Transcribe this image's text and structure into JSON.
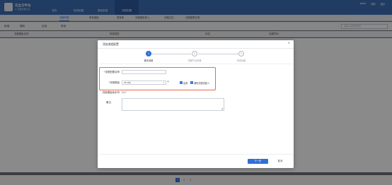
{
  "app": {
    "brand": "云立方平台",
    "brand_sub": "IT 运维管理平台",
    "nav": [
      "首页",
      "系统配置",
      "基础数据",
      "流程配置"
    ],
    "topright": [
      "admin",
      "帮助",
      "退出"
    ]
  },
  "subtabs": [
    "流程列表",
    "审批模板",
    "表单库",
    "流程模板导入",
    "流程日志",
    "流程配置记录"
  ],
  "toolbar": {
    "add": "新增",
    "delete": "删除",
    "enable": "启用",
    "disable": "禁用",
    "search_placeholder": "请输入关键字搜索"
  },
  "table_headers": [
    "流程模板名称",
    "所属类型",
    "状态",
    "创建时间"
  ],
  "pager": [
    "1",
    "2",
    "3"
  ],
  "modal": {
    "title": "添加流程配置",
    "close": "×",
    "steps": [
      {
        "num": "1",
        "label": "基本设置",
        "active": true
      },
      {
        "num": "2",
        "label": "流程节点设置",
        "active": false
      },
      {
        "num": "3",
        "label": "完成设置",
        "active": false
      }
    ],
    "form": {
      "name_label": "流程配置名称:",
      "name_value": "",
      "template_label": "*流程模板:",
      "template_value": "cs-xaq",
      "plus": "+",
      "enable_label": "启用",
      "notify_label": "通知流程发起人",
      "version_label": "流程模板版本号:",
      "version_value": "24.7",
      "remark_label": "备注:"
    },
    "next_button": "下一步",
    "cancel_button": "取消"
  }
}
